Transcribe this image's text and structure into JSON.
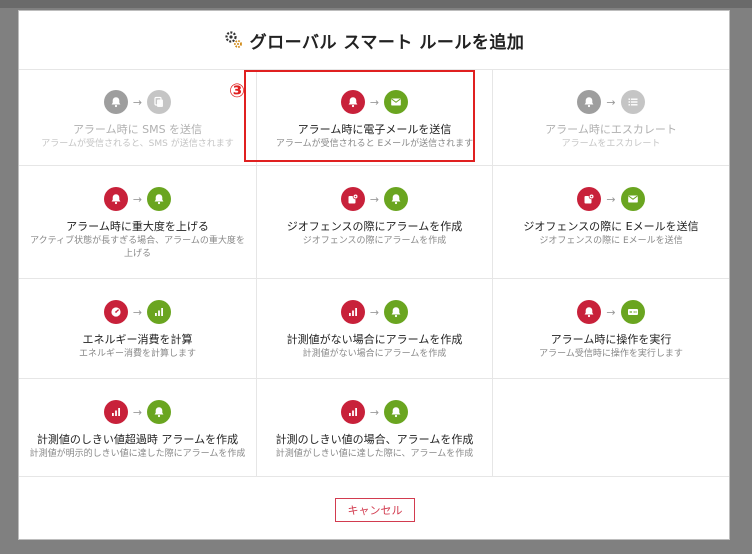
{
  "title": "グローバル スマート ルールを追加",
  "step_marker": "③",
  "cancel_label": "キャンセル",
  "colors": {
    "red": "#c8213a",
    "green": "#6aa520",
    "gray": "#9e9e9e",
    "lightgray": "#c5c5c5",
    "highlight": "#e02020"
  },
  "rules": [
    {
      "label": "アラーム時に SMS を送信",
      "desc": "アラームが受信されると、SMS が送信されます",
      "from_icon": "bell-icon",
      "to_icon": "sms-icon",
      "disabled": true
    },
    {
      "label": "アラーム時に電子メールを送信",
      "desc": "アラームが受信されると Eメールが送信されます",
      "from_icon": "bell-icon",
      "to_icon": "envelope-icon",
      "disabled": false
    },
    {
      "label": "アラーム時にエスカレート",
      "desc": "アラームをエスカレート",
      "from_icon": "bell-icon",
      "to_icon": "list-icon",
      "disabled": true
    },
    {
      "label": "アラーム時に重大度を上げる",
      "desc": "アクティブ状態が長すぎる場合、アラームの重大度を上げる",
      "from_icon": "bell-icon",
      "to_icon": "bell-icon",
      "disabled": false
    },
    {
      "label": "ジオフェンスの際にアラームを作成",
      "desc": "ジオフェンスの際にアラームを作成",
      "from_icon": "geofence-icon",
      "to_icon": "bell-icon",
      "disabled": false
    },
    {
      "label": "ジオフェンスの際に Eメールを送信",
      "desc": "ジオフェンスの際に Eメールを送信",
      "from_icon": "geofence-icon",
      "to_icon": "envelope-icon",
      "disabled": false
    },
    {
      "label": "エネルギー消費を計算",
      "desc": "エネルギー消費を計算します",
      "from_icon": "gauge-icon",
      "to_icon": "bar-chart-icon",
      "disabled": false
    },
    {
      "label": "計測値がない場合にアラームを作成",
      "desc": "計測値がない場合にアラームを作成",
      "from_icon": "bar-chart-icon",
      "to_icon": "bell-icon",
      "disabled": false
    },
    {
      "label": "アラーム時に操作を実行",
      "desc": "アラーム受信時に操作を実行します",
      "from_icon": "bell-icon",
      "to_icon": "operation-icon",
      "disabled": false
    },
    {
      "label": "計測値のしきい値超過時 アラームを作成",
      "desc": "計測値が明示的しきい値に達した際にアラームを作成",
      "from_icon": "bar-chart-icon",
      "to_icon": "bell-icon",
      "disabled": false
    },
    {
      "label": "計測のしきい値の場合、アラームを作成",
      "desc": "計測値がしきい値に達した際に、アラームを作成",
      "from_icon": "bar-chart-icon",
      "to_icon": "bell-icon",
      "disabled": false
    }
  ]
}
